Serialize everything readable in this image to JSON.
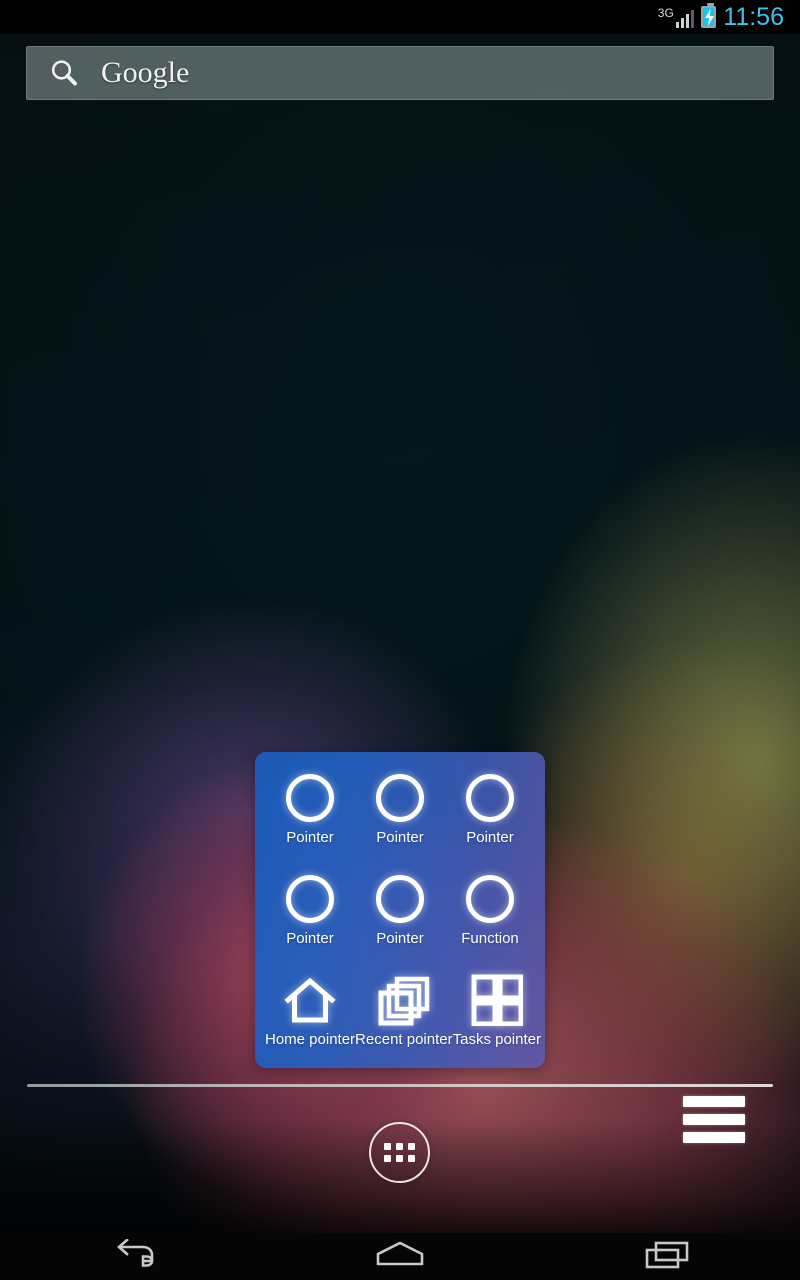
{
  "status_bar": {
    "network_label": "3G",
    "signal_icon": "signal-bars-icon",
    "battery_icon": "battery-charging-icon",
    "clock": "11:56",
    "clock_color": "#39c2ee"
  },
  "search": {
    "icon": "search-icon",
    "logo_text": "Google",
    "placeholder": "Google"
  },
  "pointer_panel": {
    "accent_color": "#1d5dbe",
    "rows": [
      [
        {
          "icon": "circle-outline-icon",
          "label": "Pointer"
        },
        {
          "icon": "circle-outline-icon",
          "label": "Pointer"
        },
        {
          "icon": "circle-outline-icon",
          "label": "Pointer"
        }
      ],
      [
        {
          "icon": "circle-outline-icon",
          "label": "Pointer"
        },
        {
          "icon": "circle-outline-icon",
          "label": "Pointer"
        },
        {
          "icon": "circle-outline-icon",
          "label": "Function"
        }
      ],
      [
        {
          "icon": "home-outline-icon",
          "label": "Home pointer"
        },
        {
          "icon": "recent-stack-icon",
          "label": "Recent pointer"
        },
        {
          "icon": "tasks-grid-icon",
          "label": "Tasks pointer"
        }
      ]
    ]
  },
  "dock": {
    "app_drawer": {
      "icon": "app-drawer-grid-icon",
      "label": "Apps"
    },
    "menu": {
      "icon": "hamburger-menu-icon",
      "label": "Menu"
    }
  },
  "nav_bar": {
    "buttons": [
      {
        "icon": "back-arrow-icon",
        "label": "Back"
      },
      {
        "icon": "home-icon",
        "label": "Home"
      },
      {
        "icon": "recents-icon",
        "label": "Recents"
      }
    ]
  }
}
